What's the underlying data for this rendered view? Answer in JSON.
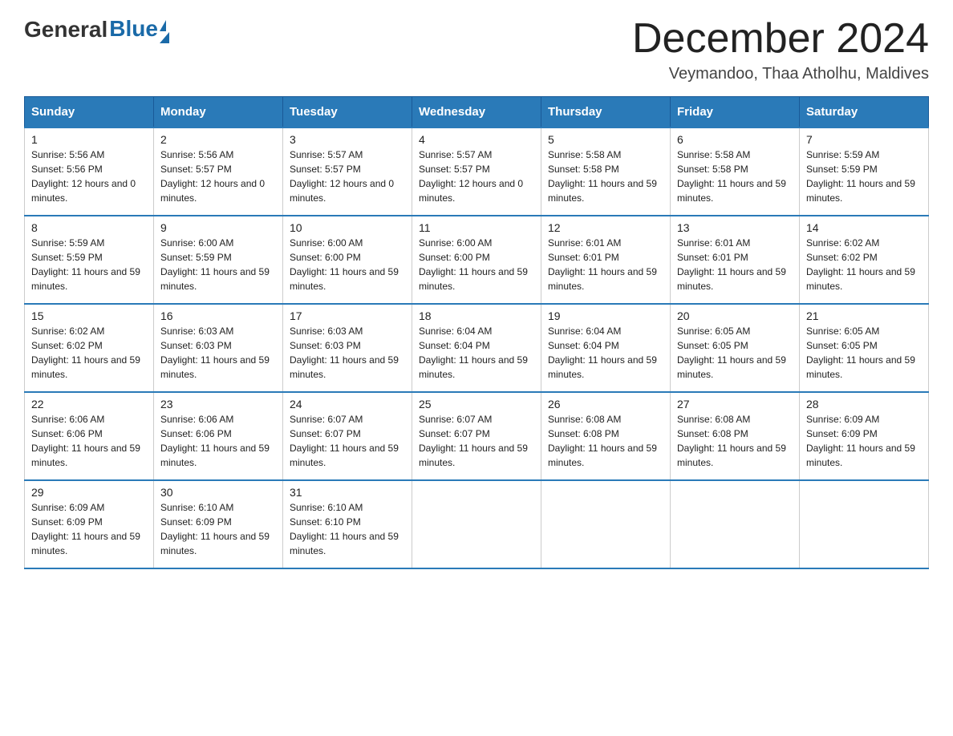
{
  "header": {
    "logo": {
      "general": "General",
      "blue": "Blue"
    },
    "title": "December 2024",
    "subtitle": "Veymandoo, Thaa Atholhu, Maldives"
  },
  "columns": [
    "Sunday",
    "Monday",
    "Tuesday",
    "Wednesday",
    "Thursday",
    "Friday",
    "Saturday"
  ],
  "weeks": [
    [
      {
        "day": "1",
        "sunrise": "5:56 AM",
        "sunset": "5:56 PM",
        "daylight": "12 hours and 0 minutes."
      },
      {
        "day": "2",
        "sunrise": "5:56 AM",
        "sunset": "5:57 PM",
        "daylight": "12 hours and 0 minutes."
      },
      {
        "day": "3",
        "sunrise": "5:57 AM",
        "sunset": "5:57 PM",
        "daylight": "12 hours and 0 minutes."
      },
      {
        "day": "4",
        "sunrise": "5:57 AM",
        "sunset": "5:57 PM",
        "daylight": "12 hours and 0 minutes."
      },
      {
        "day": "5",
        "sunrise": "5:58 AM",
        "sunset": "5:58 PM",
        "daylight": "11 hours and 59 minutes."
      },
      {
        "day": "6",
        "sunrise": "5:58 AM",
        "sunset": "5:58 PM",
        "daylight": "11 hours and 59 minutes."
      },
      {
        "day": "7",
        "sunrise": "5:59 AM",
        "sunset": "5:59 PM",
        "daylight": "11 hours and 59 minutes."
      }
    ],
    [
      {
        "day": "8",
        "sunrise": "5:59 AM",
        "sunset": "5:59 PM",
        "daylight": "11 hours and 59 minutes."
      },
      {
        "day": "9",
        "sunrise": "6:00 AM",
        "sunset": "5:59 PM",
        "daylight": "11 hours and 59 minutes."
      },
      {
        "day": "10",
        "sunrise": "6:00 AM",
        "sunset": "6:00 PM",
        "daylight": "11 hours and 59 minutes."
      },
      {
        "day": "11",
        "sunrise": "6:00 AM",
        "sunset": "6:00 PM",
        "daylight": "11 hours and 59 minutes."
      },
      {
        "day": "12",
        "sunrise": "6:01 AM",
        "sunset": "6:01 PM",
        "daylight": "11 hours and 59 minutes."
      },
      {
        "day": "13",
        "sunrise": "6:01 AM",
        "sunset": "6:01 PM",
        "daylight": "11 hours and 59 minutes."
      },
      {
        "day": "14",
        "sunrise": "6:02 AM",
        "sunset": "6:02 PM",
        "daylight": "11 hours and 59 minutes."
      }
    ],
    [
      {
        "day": "15",
        "sunrise": "6:02 AM",
        "sunset": "6:02 PM",
        "daylight": "11 hours and 59 minutes."
      },
      {
        "day": "16",
        "sunrise": "6:03 AM",
        "sunset": "6:03 PM",
        "daylight": "11 hours and 59 minutes."
      },
      {
        "day": "17",
        "sunrise": "6:03 AM",
        "sunset": "6:03 PM",
        "daylight": "11 hours and 59 minutes."
      },
      {
        "day": "18",
        "sunrise": "6:04 AM",
        "sunset": "6:04 PM",
        "daylight": "11 hours and 59 minutes."
      },
      {
        "day": "19",
        "sunrise": "6:04 AM",
        "sunset": "6:04 PM",
        "daylight": "11 hours and 59 minutes."
      },
      {
        "day": "20",
        "sunrise": "6:05 AM",
        "sunset": "6:05 PM",
        "daylight": "11 hours and 59 minutes."
      },
      {
        "day": "21",
        "sunrise": "6:05 AM",
        "sunset": "6:05 PM",
        "daylight": "11 hours and 59 minutes."
      }
    ],
    [
      {
        "day": "22",
        "sunrise": "6:06 AM",
        "sunset": "6:06 PM",
        "daylight": "11 hours and 59 minutes."
      },
      {
        "day": "23",
        "sunrise": "6:06 AM",
        "sunset": "6:06 PM",
        "daylight": "11 hours and 59 minutes."
      },
      {
        "day": "24",
        "sunrise": "6:07 AM",
        "sunset": "6:07 PM",
        "daylight": "11 hours and 59 minutes."
      },
      {
        "day": "25",
        "sunrise": "6:07 AM",
        "sunset": "6:07 PM",
        "daylight": "11 hours and 59 minutes."
      },
      {
        "day": "26",
        "sunrise": "6:08 AM",
        "sunset": "6:08 PM",
        "daylight": "11 hours and 59 minutes."
      },
      {
        "day": "27",
        "sunrise": "6:08 AM",
        "sunset": "6:08 PM",
        "daylight": "11 hours and 59 minutes."
      },
      {
        "day": "28",
        "sunrise": "6:09 AM",
        "sunset": "6:09 PM",
        "daylight": "11 hours and 59 minutes."
      }
    ],
    [
      {
        "day": "29",
        "sunrise": "6:09 AM",
        "sunset": "6:09 PM",
        "daylight": "11 hours and 59 minutes."
      },
      {
        "day": "30",
        "sunrise": "6:10 AM",
        "sunset": "6:09 PM",
        "daylight": "11 hours and 59 minutes."
      },
      {
        "day": "31",
        "sunrise": "6:10 AM",
        "sunset": "6:10 PM",
        "daylight": "11 hours and 59 minutes."
      },
      null,
      null,
      null,
      null
    ]
  ]
}
